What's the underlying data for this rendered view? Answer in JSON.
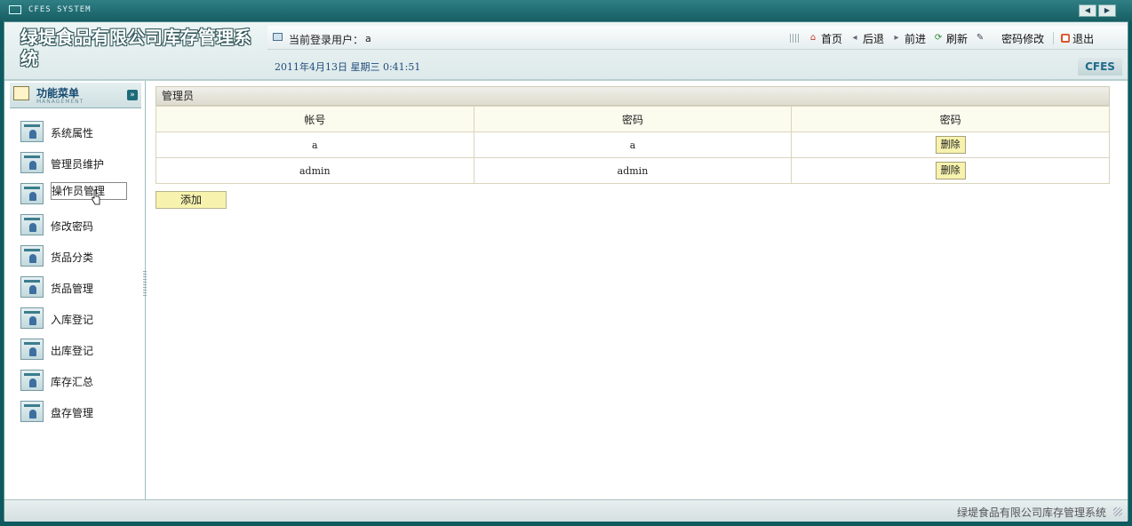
{
  "window": {
    "title": "CFES SYSTEM"
  },
  "header": {
    "system_name": "绿堤食品有限公司库存管理系统",
    "user_label": "当前登录用户：",
    "user_name": "a",
    "datetime": "2011年4月13日  星期三  0:41:51",
    "brand": "CFES",
    "toolbar": [
      {
        "label": "首页",
        "icon": "home-icon"
      },
      {
        "label": "后退",
        "icon": "back-icon"
      },
      {
        "label": "前进",
        "icon": "forward-icon"
      },
      {
        "label": "刷新",
        "icon": "refresh-icon"
      },
      {
        "label": "密码修改",
        "icon": "edit-icon"
      },
      {
        "label": "退出",
        "icon": "exit-icon"
      }
    ]
  },
  "sidebar": {
    "title": "功能菜单",
    "subtitle": "MANAGEMENT",
    "items": [
      {
        "label": "系统属性"
      },
      {
        "label": "管理员维护"
      },
      {
        "label": "操作员管理"
      },
      {
        "label": "修改密码"
      },
      {
        "label": "货品分类"
      },
      {
        "label": "货品管理"
      },
      {
        "label": "入库登记"
      },
      {
        "label": "出库登记"
      },
      {
        "label": "库存汇总"
      },
      {
        "label": "盘存管理"
      }
    ]
  },
  "main": {
    "panel_title": "管理员",
    "columns": [
      "帐号",
      "密码",
      "密码"
    ],
    "rows": [
      {
        "account": "a",
        "password": "a",
        "action": "删除"
      },
      {
        "account": "admin",
        "password": "admin",
        "action": "删除"
      }
    ],
    "add_label": "添加"
  },
  "footer": {
    "text": "绿堤食品有限公司库存管理系统"
  },
  "colors": {
    "frame": "#0f5a5e",
    "button": "#f7f3ae",
    "date_text": "#1f4c7a"
  }
}
